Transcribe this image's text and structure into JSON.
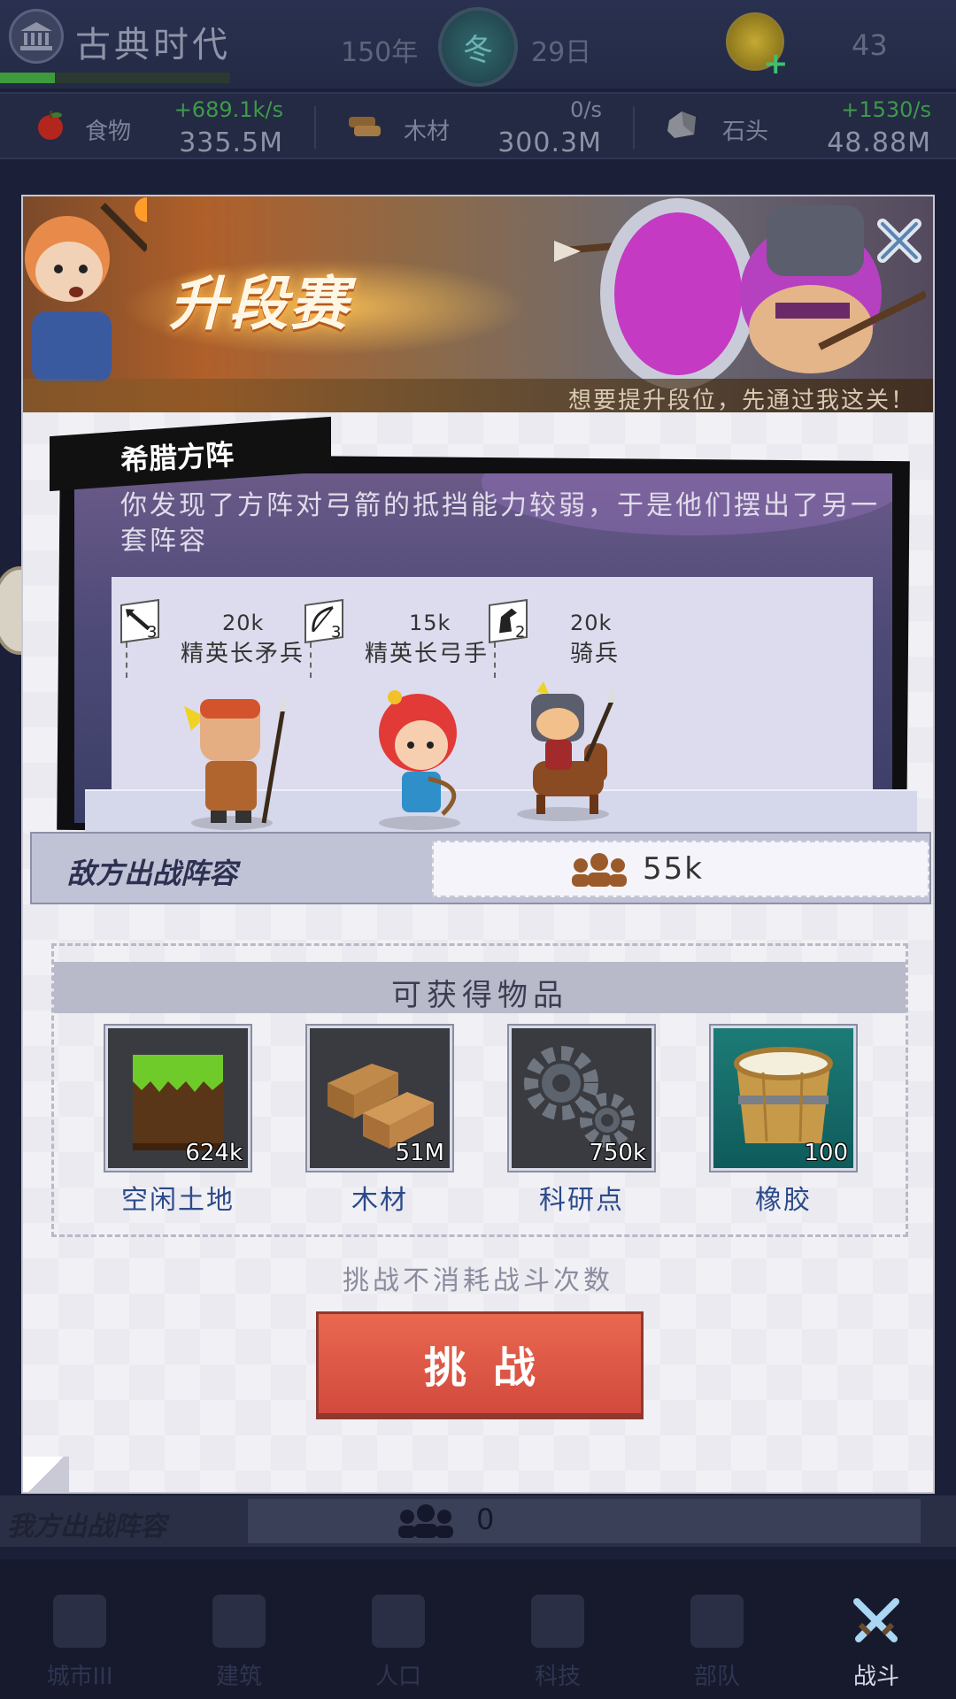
{
  "topbar": {
    "era_title": "古典时代",
    "era_progress": 0.24,
    "year": "150年",
    "season": "冬",
    "day": "29日",
    "coin_count": "43"
  },
  "resources": [
    {
      "name": "食物",
      "rate": "+689.1k/s",
      "amount": "335.5M",
      "rate_color": "#3e9a4a"
    },
    {
      "name": "木材",
      "rate": "0/s",
      "amount": "300.3M",
      "rate_color": "#7d8299"
    },
    {
      "name": "石头",
      "rate": "+1530/s",
      "amount": "48.88M",
      "rate_color": "#3e9a4a"
    }
  ],
  "modal": {
    "banner_title": "升段赛",
    "banner_sub": "想要提升段位，先通过我这关！",
    "stage_name": "希腊方阵",
    "stage_desc": "你发现了方阵对弓箭的抵挡能力较弱，于是他们摆出了另一套阵容",
    "units": [
      {
        "flag": "3",
        "count": "20k",
        "name": "精英长矛兵"
      },
      {
        "flag": "3",
        "count": "15k",
        "name": "精英长弓手"
      },
      {
        "flag": "2",
        "count": "20k",
        "name": "骑兵"
      }
    ],
    "enemy_label": "敌方出战阵容",
    "enemy_count": "55k",
    "rewards_title": "可获得物品",
    "rewards": [
      {
        "name": "空闲土地",
        "qty": "624k",
        "icon": "grass-land-icon"
      },
      {
        "name": "木材",
        "qty": "51M",
        "icon": "wood-logs-icon"
      },
      {
        "name": "科研点",
        "qty": "750k",
        "icon": "gears-icon"
      },
      {
        "name": "橡胶",
        "qty": "100",
        "icon": "rubber-bucket-icon"
      }
    ],
    "no_cost_text": "挑战不消耗战斗次数",
    "challenge_label": "挑战"
  },
  "own_lineup": {
    "label": "我方出战阵容",
    "count": "0"
  },
  "nav": [
    {
      "label": "城市III",
      "icon": "castle-icon"
    },
    {
      "label": "建筑",
      "icon": "house-icon"
    },
    {
      "label": "人口",
      "icon": "person-icon"
    },
    {
      "label": "科技",
      "icon": "book-icon"
    },
    {
      "label": "部队",
      "icon": "banner-icon"
    },
    {
      "label": "战斗",
      "icon": "crossed-swords-icon"
    }
  ],
  "colors": {
    "accent_red": "#d24a3e",
    "reward_label_blue": "#2c4a8a",
    "background_dark": "#1b2038"
  }
}
